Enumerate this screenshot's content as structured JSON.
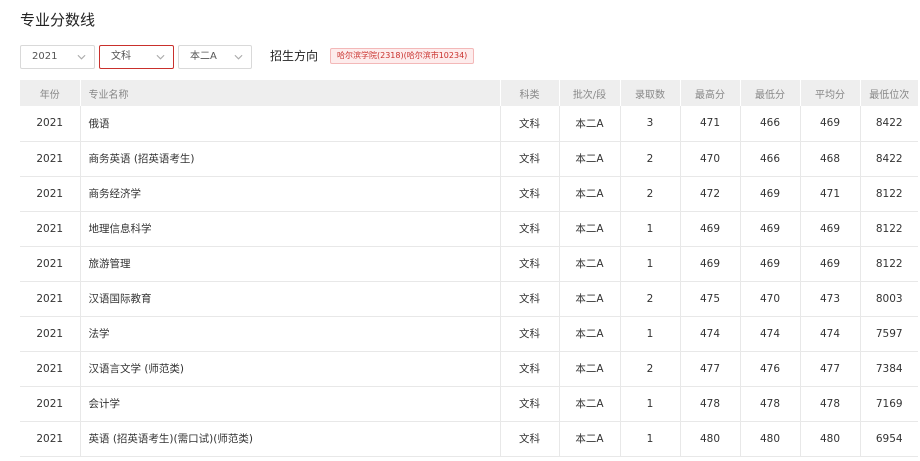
{
  "title": "专业分数线",
  "filters": {
    "year": "2021",
    "subject": "文科",
    "batch": "本二A",
    "direction_label": "招生方向",
    "campus": "哈尔滨学院(2318)(哈尔滨市10234)"
  },
  "table": {
    "headers": [
      "年份",
      "专业名称",
      "科类",
      "批次/段",
      "录取数",
      "最高分",
      "最低分",
      "平均分",
      "最低位次"
    ],
    "rows": [
      [
        "2021",
        "俄语",
        "文科",
        "本二A",
        "3",
        "471",
        "466",
        "469",
        "8422"
      ],
      [
        "2021",
        "商务英语 (招英语考生)",
        "文科",
        "本二A",
        "2",
        "470",
        "466",
        "468",
        "8422"
      ],
      [
        "2021",
        "商务经济学",
        "文科",
        "本二A",
        "2",
        "472",
        "469",
        "471",
        "8122"
      ],
      [
        "2021",
        "地理信息科学",
        "文科",
        "本二A",
        "1",
        "469",
        "469",
        "469",
        "8122"
      ],
      [
        "2021",
        "旅游管理",
        "文科",
        "本二A",
        "1",
        "469",
        "469",
        "469",
        "8122"
      ],
      [
        "2021",
        "汉语国际教育",
        "文科",
        "本二A",
        "2",
        "475",
        "470",
        "473",
        "8003"
      ],
      [
        "2021",
        "法学",
        "文科",
        "本二A",
        "1",
        "474",
        "474",
        "474",
        "7597"
      ],
      [
        "2021",
        "汉语言文学 (师范类)",
        "文科",
        "本二A",
        "2",
        "477",
        "476",
        "477",
        "7384"
      ],
      [
        "2021",
        "会计学",
        "文科",
        "本二A",
        "1",
        "478",
        "478",
        "478",
        "7169"
      ],
      [
        "2021",
        "英语 (招英语考生)(需口试)(师范类)",
        "文科",
        "本二A",
        "1",
        "480",
        "480",
        "480",
        "6954"
      ]
    ]
  }
}
